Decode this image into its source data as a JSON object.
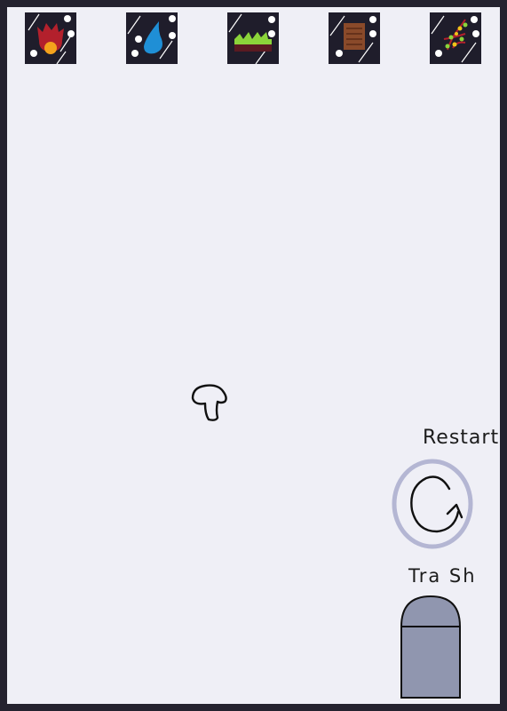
{
  "elements": [
    {
      "name": "fire",
      "icon": "fire-icon"
    },
    {
      "name": "water",
      "icon": "water-drop-icon"
    },
    {
      "name": "earth",
      "icon": "grass-earth-icon"
    },
    {
      "name": "wood",
      "icon": "wood-plank-icon"
    },
    {
      "name": "plant",
      "icon": "plant-vine-icon"
    }
  ],
  "workspace": {
    "item_icon": "mushroom-icon"
  },
  "controls": {
    "restart_label": "Restart",
    "restart_icon": "restart-arrow-icon",
    "trash_label": "Tra Sh",
    "trash_icon": "trash-bin-icon"
  },
  "colors": {
    "frame": "#24222f",
    "board": "#efeff6",
    "tile": "#1f1d2b",
    "restart_ring": "#b4b6d3",
    "trash_bin": "#9096af"
  }
}
